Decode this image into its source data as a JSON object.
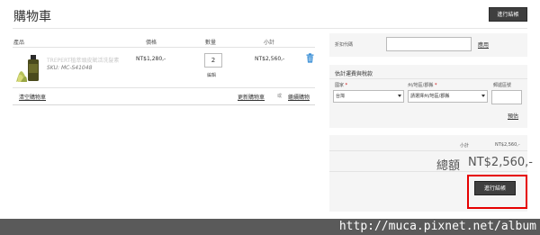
{
  "page": {
    "title": "購物車",
    "checkout_label": "進行結帳"
  },
  "table": {
    "headers": {
      "product": "產品",
      "price": "價格",
      "quantity": "數量",
      "subtotal": "小計"
    },
    "item": {
      "name": "TREPERT植萃頭皮賦活洗髮素",
      "sku": "SKU: MC-S41048",
      "price": "NT$1,280,-",
      "quantity": "2",
      "edit_label": "編輯",
      "subtotal": "NT$2,560,-"
    },
    "actions": {
      "clear": "清空購物車",
      "update": "更新購物車",
      "or": "或",
      "continue": "繼續購物"
    }
  },
  "coupon": {
    "label": "折扣代碼",
    "value": "",
    "apply_label": "應用"
  },
  "shipping": {
    "title": "估計運費與稅款",
    "country_label": "國家",
    "country_value": "台灣",
    "region_label": "州/地區/郡縣",
    "region_value": "請選擇州/地區/郡縣",
    "zip_label": "郵遞區號",
    "zip_value": "",
    "required_mark": "*",
    "estimate_label": "預估"
  },
  "totals": {
    "subtotal_label": "小計",
    "subtotal_value": "NT$2,560,-",
    "grand_label": "總額",
    "grand_value": "NT$2,560,-",
    "checkout_label": "進行結帳"
  },
  "watermark": "http://muca.pixnet.net/album",
  "colors": {
    "button_bg": "#3f3f3f",
    "highlight": "#e60000",
    "trash_icon": "#3a8fd6"
  }
}
